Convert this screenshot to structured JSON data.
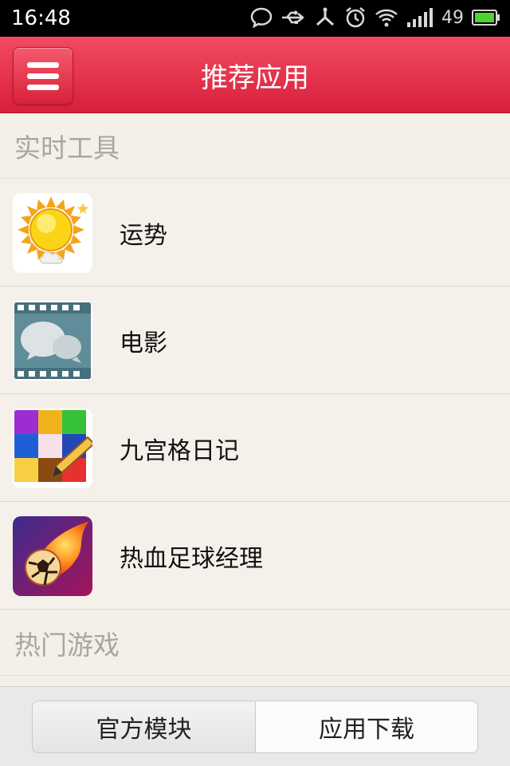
{
  "status_bar": {
    "time": "16:48",
    "battery_level": "49",
    "icons": [
      "chat-bubble-icon",
      "usb-icon",
      "fork-icon",
      "alarm-icon",
      "wifi-icon",
      "signal-icon",
      "battery-icon"
    ]
  },
  "header": {
    "title": "推荐应用",
    "menu_icon": "hamburger-icon"
  },
  "sections": [
    {
      "title": "实时工具",
      "items": [
        {
          "label": "运势",
          "icon": "sun-icon"
        },
        {
          "label": "电影",
          "icon": "film-chat-icon"
        },
        {
          "label": "九宫格日记",
          "icon": "grid-diary-icon"
        },
        {
          "label": "热血足球经理",
          "icon": "flaming-football-icon"
        }
      ]
    },
    {
      "title": "热门游戏",
      "items": []
    }
  ],
  "bottom_tabs": {
    "left": "官方模块",
    "right": "应用下载"
  },
  "colors": {
    "header_red": "#e02a44",
    "background": "#f4efe8"
  }
}
